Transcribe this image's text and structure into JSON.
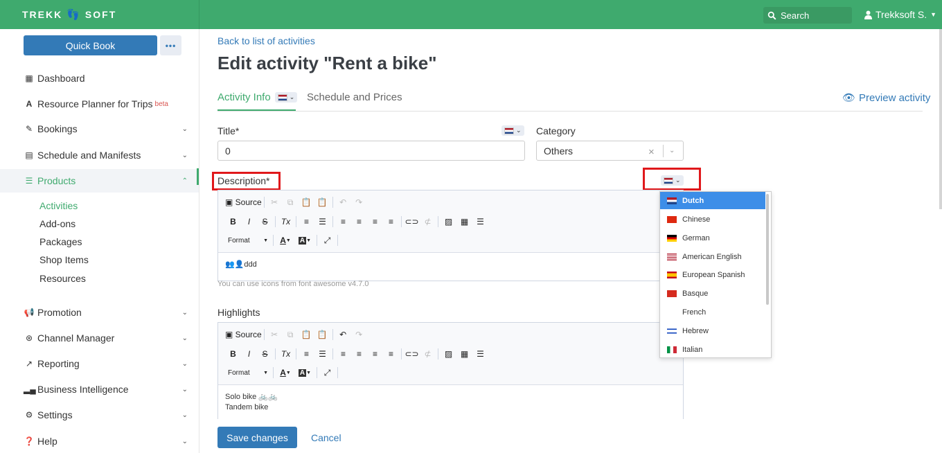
{
  "header": {
    "logo_left": "TREKK",
    "logo_right": "SOFT",
    "search_label": "Search",
    "user_name": "Trekksoft S."
  },
  "sidebar": {
    "quick_book": "Quick Book",
    "more": "•••",
    "items": [
      {
        "label": "Dashboard"
      },
      {
        "label": "Resource Planner for Trips",
        "badge": "beta"
      },
      {
        "label": "Bookings"
      },
      {
        "label": "Schedule and Manifests"
      },
      {
        "label": "Products"
      },
      {
        "label": "Promotion"
      },
      {
        "label": "Channel Manager"
      },
      {
        "label": "Reporting"
      },
      {
        "label": "Business Intelligence"
      },
      {
        "label": "Settings"
      },
      {
        "label": "Help"
      }
    ],
    "products_sub": [
      "Activities",
      "Add-ons",
      "Packages",
      "Shop Items",
      "Resources"
    ]
  },
  "main": {
    "back_link": "Back to list of activities",
    "title": "Edit activity \"Rent a bike\"",
    "tabs": [
      {
        "label": "Activity Info"
      },
      {
        "label": "Schedule and Prices"
      }
    ],
    "preview": "Preview activity",
    "form": {
      "title_label": "Title*",
      "title_value": "0",
      "category_label": "Category",
      "category_value": "Others",
      "description_label": "Description*",
      "description_content": "ddd",
      "description_hint": "You can use icons from font awesome v4.7.0",
      "highlights_label": "Highlights",
      "highlights_line1": "Solo bike",
      "highlights_line2": "Tandem bike"
    },
    "editor": {
      "source": "Source",
      "format": "Format"
    },
    "language_options": [
      "Dutch",
      "Chinese",
      "German",
      "American English",
      "European Spanish",
      "Basque",
      "French",
      "Hebrew",
      "Italian"
    ],
    "selected_language": "Dutch",
    "save": "Save changes",
    "cancel": "Cancel"
  }
}
